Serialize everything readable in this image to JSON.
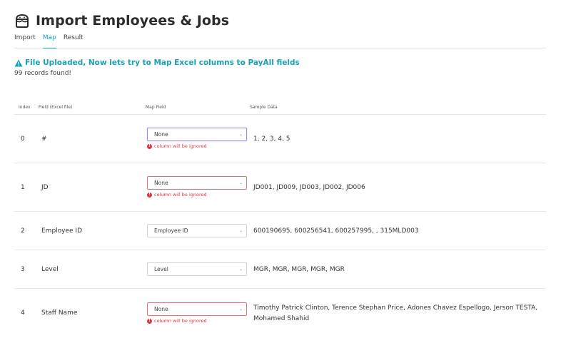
{
  "header": {
    "title": "Import Employees & Jobs",
    "icon": "cake-icon"
  },
  "tabs": [
    {
      "label": "Import",
      "active": false
    },
    {
      "label": "Map",
      "active": true
    },
    {
      "label": "Result",
      "active": false
    }
  ],
  "alert": {
    "title": "File Uploaded, Now lets try to Map Excel columns to PayAll fields",
    "records": "99 records found!",
    "color": "#17a2b8"
  },
  "table": {
    "headers": {
      "index": "Index",
      "field": "Field (Excel file)",
      "map": "Map Field",
      "sample": "Sample Data"
    },
    "warning_text": "column will be ignored",
    "rows": [
      {
        "index": "0",
        "field": "#",
        "map": "None",
        "sample": "1, 2, 3, 4, 5"
      },
      {
        "index": "1",
        "field": "JD",
        "map": "None",
        "sample": "JD001, JD009, JD003, JD002, JD006"
      },
      {
        "index": "2",
        "field": "Employee ID",
        "map": "Employee ID",
        "sample": "600190695, 600256541, 600257995, , 315MLD003"
      },
      {
        "index": "3",
        "field": "Level",
        "map": "Level",
        "sample": "MGR, MGR, MGR, MGR, MGR"
      },
      {
        "index": "4",
        "field": "Staff Name",
        "map": "None",
        "sample": "Timothy Patrick Clinton, Terence Stephan Price, Adones Chavez Espellogo, Jerson TESTA, Mohamed Shahid"
      }
    ]
  },
  "colors": {
    "accent": "#17a2b8",
    "error": "#dc3545",
    "error_border": "#e57373"
  }
}
